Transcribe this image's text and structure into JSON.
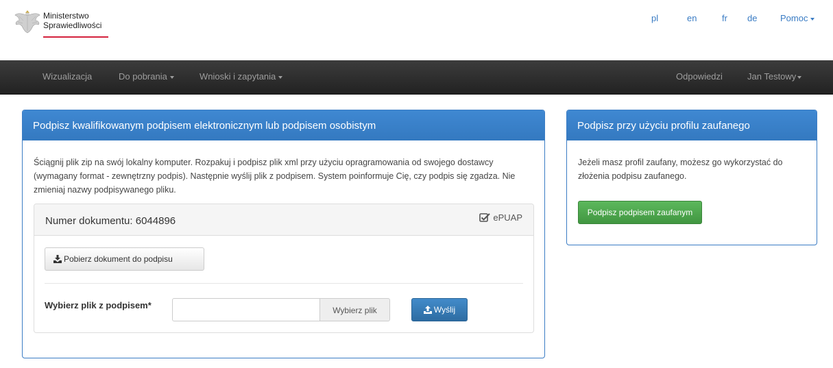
{
  "header": {
    "logo_line1": "Ministerstwo",
    "logo_line2": "Sprawiedliwości",
    "languages": [
      "pl",
      "en",
      "fr",
      "de"
    ],
    "help_label": "Pomoc"
  },
  "navbar": {
    "visualization": "Wizualizacja",
    "downloads": "Do pobrania",
    "requests": "Wnioski i zapytania",
    "responses": "Odpowiedzi",
    "user": "Jan Testowy"
  },
  "qualified_panel": {
    "title": "Podpisz kwalifikowanym podpisem elektronicznym lub podpisem osobistym",
    "intro": "Ściągnij plik zip na swój lokalny komputer. Rozpakuj i podpisz plik xml przy użyciu opragramowania od swojego dostawcy (wymagany format - zewnętrzny podpis). Następnie wyślij plik z podpisem. System poinformuje Cię, czy podpis się zgadza. Nie zmieniaj nazwy podpisywanego pliku.",
    "document_label": "Numer dokumentu: 6044896",
    "epuap_label": "ePUAP",
    "epuap_checked": true,
    "download_button": "Pobierz dokument do podpisu",
    "file_label": "Wybierz plik z podpisem*",
    "file_value": "",
    "choose_button": "Wybierz plik",
    "send_button": "Wyślij"
  },
  "trusted_panel": {
    "title": "Podpisz przy użyciu profilu zaufanego",
    "text": "Jeżeli masz profil zaufany, możesz go wykorzystać do złożenia podpisu zaufanego.",
    "button": "Podpisz podpisem zaufanym"
  },
  "colors": {
    "panel_primary": "#3479c0",
    "link": "#3a7cc4",
    "navbar": "#2b2b2b",
    "success": "#4cae4c",
    "brand_red": "#d4213d"
  }
}
